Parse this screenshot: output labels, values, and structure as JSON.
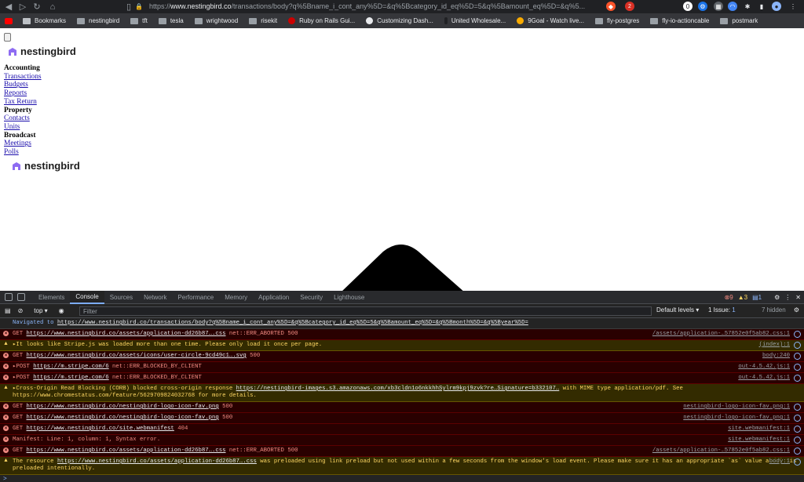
{
  "browser": {
    "url_prefix": "https://",
    "url_host": "www.nestingbird.co",
    "url_path": "/transactions/body?q%5Bname_i_cont_any%5D=&q%5Bcategory_id_eq%5D=5&q%5Bamount_eq%5D=&q%5...",
    "extension_badge": "2"
  },
  "bookmarks": [
    "Bookmarks",
    "nestingbird",
    "tft",
    "tesla",
    "wrightwood",
    "risekit",
    "Ruby on Rails Gui...",
    "Customizing Dash...",
    "United Wholesale...",
    "9Goal - Watch live...",
    "fly-postgres",
    "fly-io-actioncable",
    "postmark"
  ],
  "page": {
    "logo_text": "nestingbird",
    "nav": [
      {
        "kind": "section",
        "label": "Accounting"
      },
      {
        "kind": "link",
        "label": "Transactions"
      },
      {
        "kind": "link",
        "label": "Budgets"
      },
      {
        "kind": "link",
        "label": "Reports"
      },
      {
        "kind": "link",
        "label": "Tax Return"
      },
      {
        "kind": "section",
        "label": "Property"
      },
      {
        "kind": "link",
        "label": "Contacts"
      },
      {
        "kind": "link",
        "label": "Units"
      },
      {
        "kind": "section",
        "label": "Broadcast"
      },
      {
        "kind": "link",
        "label": "Meetings"
      },
      {
        "kind": "link",
        "label": "Polls"
      }
    ]
  },
  "devtools": {
    "tabs": [
      "Elements",
      "Console",
      "Sources",
      "Network",
      "Performance",
      "Memory",
      "Application",
      "Security",
      "Lighthouse"
    ],
    "active_tab": "Console",
    "error_count": "9",
    "warning_count": "3",
    "info_count": "1",
    "context": "top",
    "filter_placeholder": "Filter",
    "levels": "Default levels ▾",
    "issues": "1 Issue:",
    "issues_count": "1",
    "hidden": "7 hidden",
    "messages": [
      {
        "level": "info",
        "prefix": "Navigated to ",
        "link": "https://www.nestingbird.co/transactions/body?q%5Bname_i_cont_any%5D=&q%5Bcategory_id_eq%5D=5&q%5Bamount_eq%5D=&q%5Bmonth%5D=&q%5Byear%5D=",
        "suffix": "",
        "source": ""
      },
      {
        "level": "err",
        "prefix": "GET ",
        "link": "https://www.nestingbird.co/assets/application-dd26b87….css",
        "suffix": " net::ERR_ABORTED 500",
        "source": "/assets/application-…57852e0f5ab82.css:1"
      },
      {
        "level": "warn",
        "prefix": "▸It looks like Stripe.js was loaded more than one time. Please only load it once per page.",
        "link": "",
        "suffix": "",
        "source": "(index):1"
      },
      {
        "level": "err",
        "prefix": "GET ",
        "link": "https://www.nestingbird.co/assets/icons/user-circle-9cd49c1….svg",
        "suffix": " 500",
        "source": "body:240"
      },
      {
        "level": "err",
        "prefix": "▸POST ",
        "link": "https://m.stripe.com/6",
        "suffix": " net::ERR_BLOCKED_BY_CLIENT",
        "source": "out-4.5.42.js:1"
      },
      {
        "level": "err",
        "prefix": "▸POST ",
        "link": "https://m.stripe.com/6",
        "suffix": " net::ERR_BLOCKED_BY_CLIENT",
        "source": "out-4.5.42.js:1"
      },
      {
        "level": "warn",
        "prefix": "▸Cross-Origin Read Blocking (CORB) blocked cross-origin response ",
        "link": "https://nestingbird-images.s3.amazonaws.com/xb3cldn1o6nkkhhSylrm9kpj9zvk?re…Signature=b332107…",
        "suffix": " with MIME type application/pdf. See https://www.chromestatus.com/feature/5629709824032768 for more details.",
        "source": ""
      },
      {
        "level": "err",
        "prefix": "GET ",
        "link": "https://www.nestingbird.co/nestingbird-logo-icon-fav.png",
        "suffix": " 500",
        "source": "nestingbird-logo-icon-fav.png:1"
      },
      {
        "level": "err",
        "prefix": "GET ",
        "link": "https://www.nestingbird.co/nestingbird-logo-icon-fav.png",
        "suffix": " 500",
        "source": "nestingbird-logo-icon-fav.png:1"
      },
      {
        "level": "err",
        "prefix": "GET ",
        "link": "https://www.nestingbird.co/site.webmanifest",
        "suffix": " 404",
        "source": "site.webmanifest:1"
      },
      {
        "level": "err",
        "prefix": "Manifest: Line: 1, column: 1, Syntax error.",
        "link": "",
        "suffix": "",
        "source": "site.webmanifest:1"
      },
      {
        "level": "err",
        "prefix": "GET ",
        "link": "https://www.nestingbird.co/assets/application-dd26b87….css",
        "suffix": " net::ERR_ABORTED 500",
        "source": "/assets/application-…57852e0f5ab82.css:1"
      },
      {
        "level": "warn",
        "prefix": "The resource ",
        "link": "https://www.nestingbird.co/assets/application-dd26b87….css",
        "suffix": " was preloaded using link preload but not used within a few seconds from the window's load event. Please make sure it has an appropriate `as` value and it is preloaded intentionally.",
        "source": "body:1"
      }
    ],
    "prompt": ">"
  }
}
